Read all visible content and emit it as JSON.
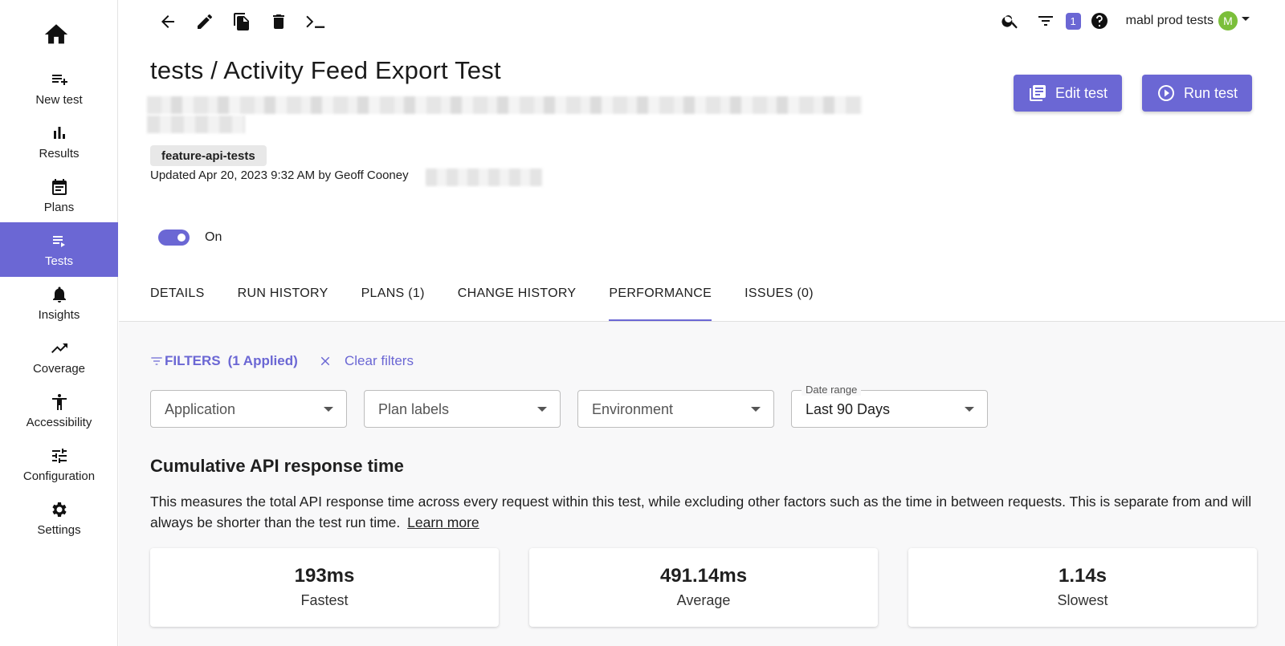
{
  "sidebar": {
    "items": [
      {
        "label": "New test",
        "icon": "playlist-add-icon"
      },
      {
        "label": "Results",
        "icon": "bar-chart-icon"
      },
      {
        "label": "Plans",
        "icon": "calendar-icon"
      },
      {
        "label": "Tests",
        "icon": "playlist-play-icon",
        "active": true
      },
      {
        "label": "Insights",
        "icon": "bell-icon"
      },
      {
        "label": "Coverage",
        "icon": "trending-up-icon"
      },
      {
        "label": "Accessibility",
        "icon": "accessibility-icon"
      },
      {
        "label": "Configuration",
        "icon": "tune-icon"
      },
      {
        "label": "Settings",
        "icon": "gear-icon"
      }
    ]
  },
  "topbar": {
    "notification_count": "1",
    "account_name": "mabl prod tests",
    "avatar_initial": "M"
  },
  "header": {
    "title": "tests / Activity Feed Export Test",
    "tag": "feature-api-tests",
    "updated": "Updated Apr 20, 2023 9:32 AM by Geoff Cooney",
    "edit_label": "Edit test",
    "run_label": "Run test",
    "toggle_label": "On"
  },
  "tabs": [
    {
      "label": "DETAILS"
    },
    {
      "label": "RUN HISTORY"
    },
    {
      "label": "PLANS (1)"
    },
    {
      "label": "CHANGE HISTORY"
    },
    {
      "label": "PERFORMANCE",
      "active": true
    },
    {
      "label": "ISSUES (0)"
    }
  ],
  "filters": {
    "label": "FILTERS",
    "applied": "(1 Applied)",
    "clear_label": "Clear filters",
    "selects": [
      {
        "value": "Application"
      },
      {
        "value": "Plan labels"
      },
      {
        "value": "Environment"
      },
      {
        "legend": "Date range",
        "value": "Last 90 Days"
      }
    ]
  },
  "section": {
    "title": "Cumulative API response time",
    "description": "This measures the total API response time across every request within this test, while excluding other factors such as the time in between requests. This is separate from and will always be shorter than the test run time.",
    "learn_more": "Learn more"
  },
  "stats": [
    {
      "value": "193ms",
      "label": "Fastest"
    },
    {
      "value": "491.14ms",
      "label": "Average"
    },
    {
      "value": "1.14s",
      "label": "Slowest"
    }
  ],
  "colors": {
    "accent": "#6b67d4",
    "avatar": "#7bbf3a"
  }
}
